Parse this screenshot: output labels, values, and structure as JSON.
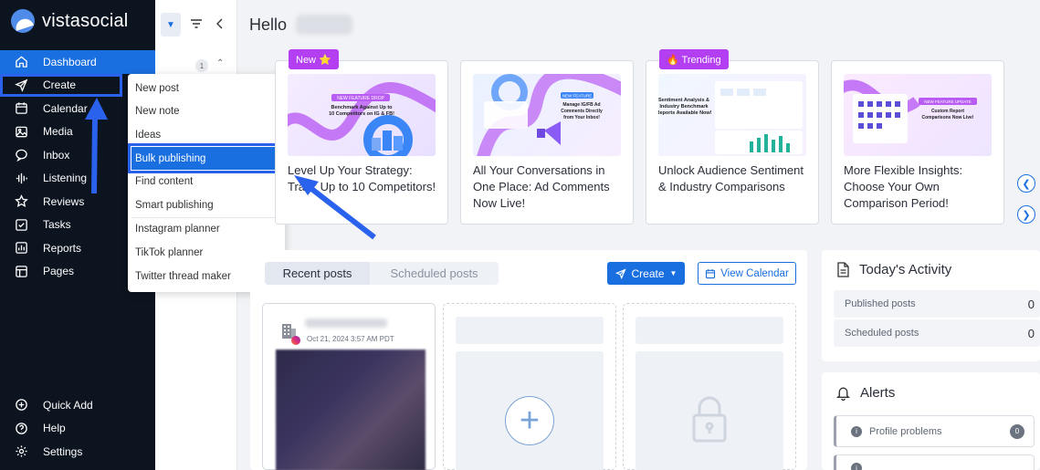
{
  "app": {
    "name": "vistasocial"
  },
  "sidebar": {
    "items": [
      {
        "label": "Dashboard",
        "icon": "home-icon"
      },
      {
        "label": "Create",
        "icon": "send-icon"
      },
      {
        "label": "Calendar",
        "icon": "calendar-icon"
      },
      {
        "label": "Media",
        "icon": "image-icon"
      },
      {
        "label": "Inbox",
        "icon": "inbox-icon"
      },
      {
        "label": "Listening",
        "icon": "wave-icon"
      },
      {
        "label": "Reviews",
        "icon": "star-icon"
      },
      {
        "label": "Tasks",
        "icon": "task-icon"
      },
      {
        "label": "Reports",
        "icon": "chart-icon"
      },
      {
        "label": "Pages",
        "icon": "pages-icon"
      }
    ],
    "bottom": [
      {
        "label": "Quick Add",
        "icon": "plus-circle-icon"
      },
      {
        "label": "Help",
        "icon": "help-icon"
      },
      {
        "label": "Settings",
        "icon": "gear-icon"
      }
    ]
  },
  "subpanel": {
    "count": "1"
  },
  "create_menu": {
    "items": [
      "New post",
      "New note",
      "Ideas",
      "Bulk publishing",
      "Find content",
      "Smart publishing",
      "Instagram planner",
      "TikTok planner",
      "Twitter thread maker"
    ],
    "selected": "Bulk publishing"
  },
  "header": {
    "greeting": "Hello"
  },
  "cards": [
    {
      "tag": "New ⭐",
      "text": "Level Up Your Strategy: Track Up to 10 Competitors!",
      "image_caption": "NEW FEATURE DROP",
      "image_text": "Benchmark Against Up to 10 Competitors on IG & FB!"
    },
    {
      "tag": "",
      "text": "All Your Conversations in One Place: Ad Comments Now Live!",
      "image_caption": "NEW FEATURE",
      "image_text": "Manage IG/FB Ad Comments Directly from Your Inbox!"
    },
    {
      "tag": "🔥 Trending",
      "text": "Unlock Audience Sentiment & Industry Comparisons",
      "image_caption": "",
      "image_text": "Sentiment Analysis & Industry Benchmark Reports Available Now!"
    },
    {
      "tag": "",
      "text": "More Flexible Insights: Choose Your Own Comparison Period!",
      "image_caption": "NEW FEATURE UPDATE",
      "image_text": "Custom Report Comparisons Now Live!"
    }
  ],
  "posts": {
    "tabs": [
      "Recent posts",
      "Scheduled posts"
    ],
    "create_label": "Create",
    "view_calendar_label": "View Calendar",
    "post_date": "Oct 21, 2024 3:57 AM PDT"
  },
  "activity": {
    "title": "Today's Activity",
    "rows": [
      {
        "label": "Published posts",
        "value": "0"
      },
      {
        "label": "Scheduled posts",
        "value": "0"
      }
    ]
  },
  "alerts": {
    "title": "Alerts",
    "rows": [
      {
        "label": "Profile problems",
        "count": "0"
      }
    ]
  },
  "colors": {
    "accent": "#1a6fe0",
    "sidebar": "#0c1420",
    "tag": "#b43ef2",
    "annotation": "#2a62ee"
  }
}
